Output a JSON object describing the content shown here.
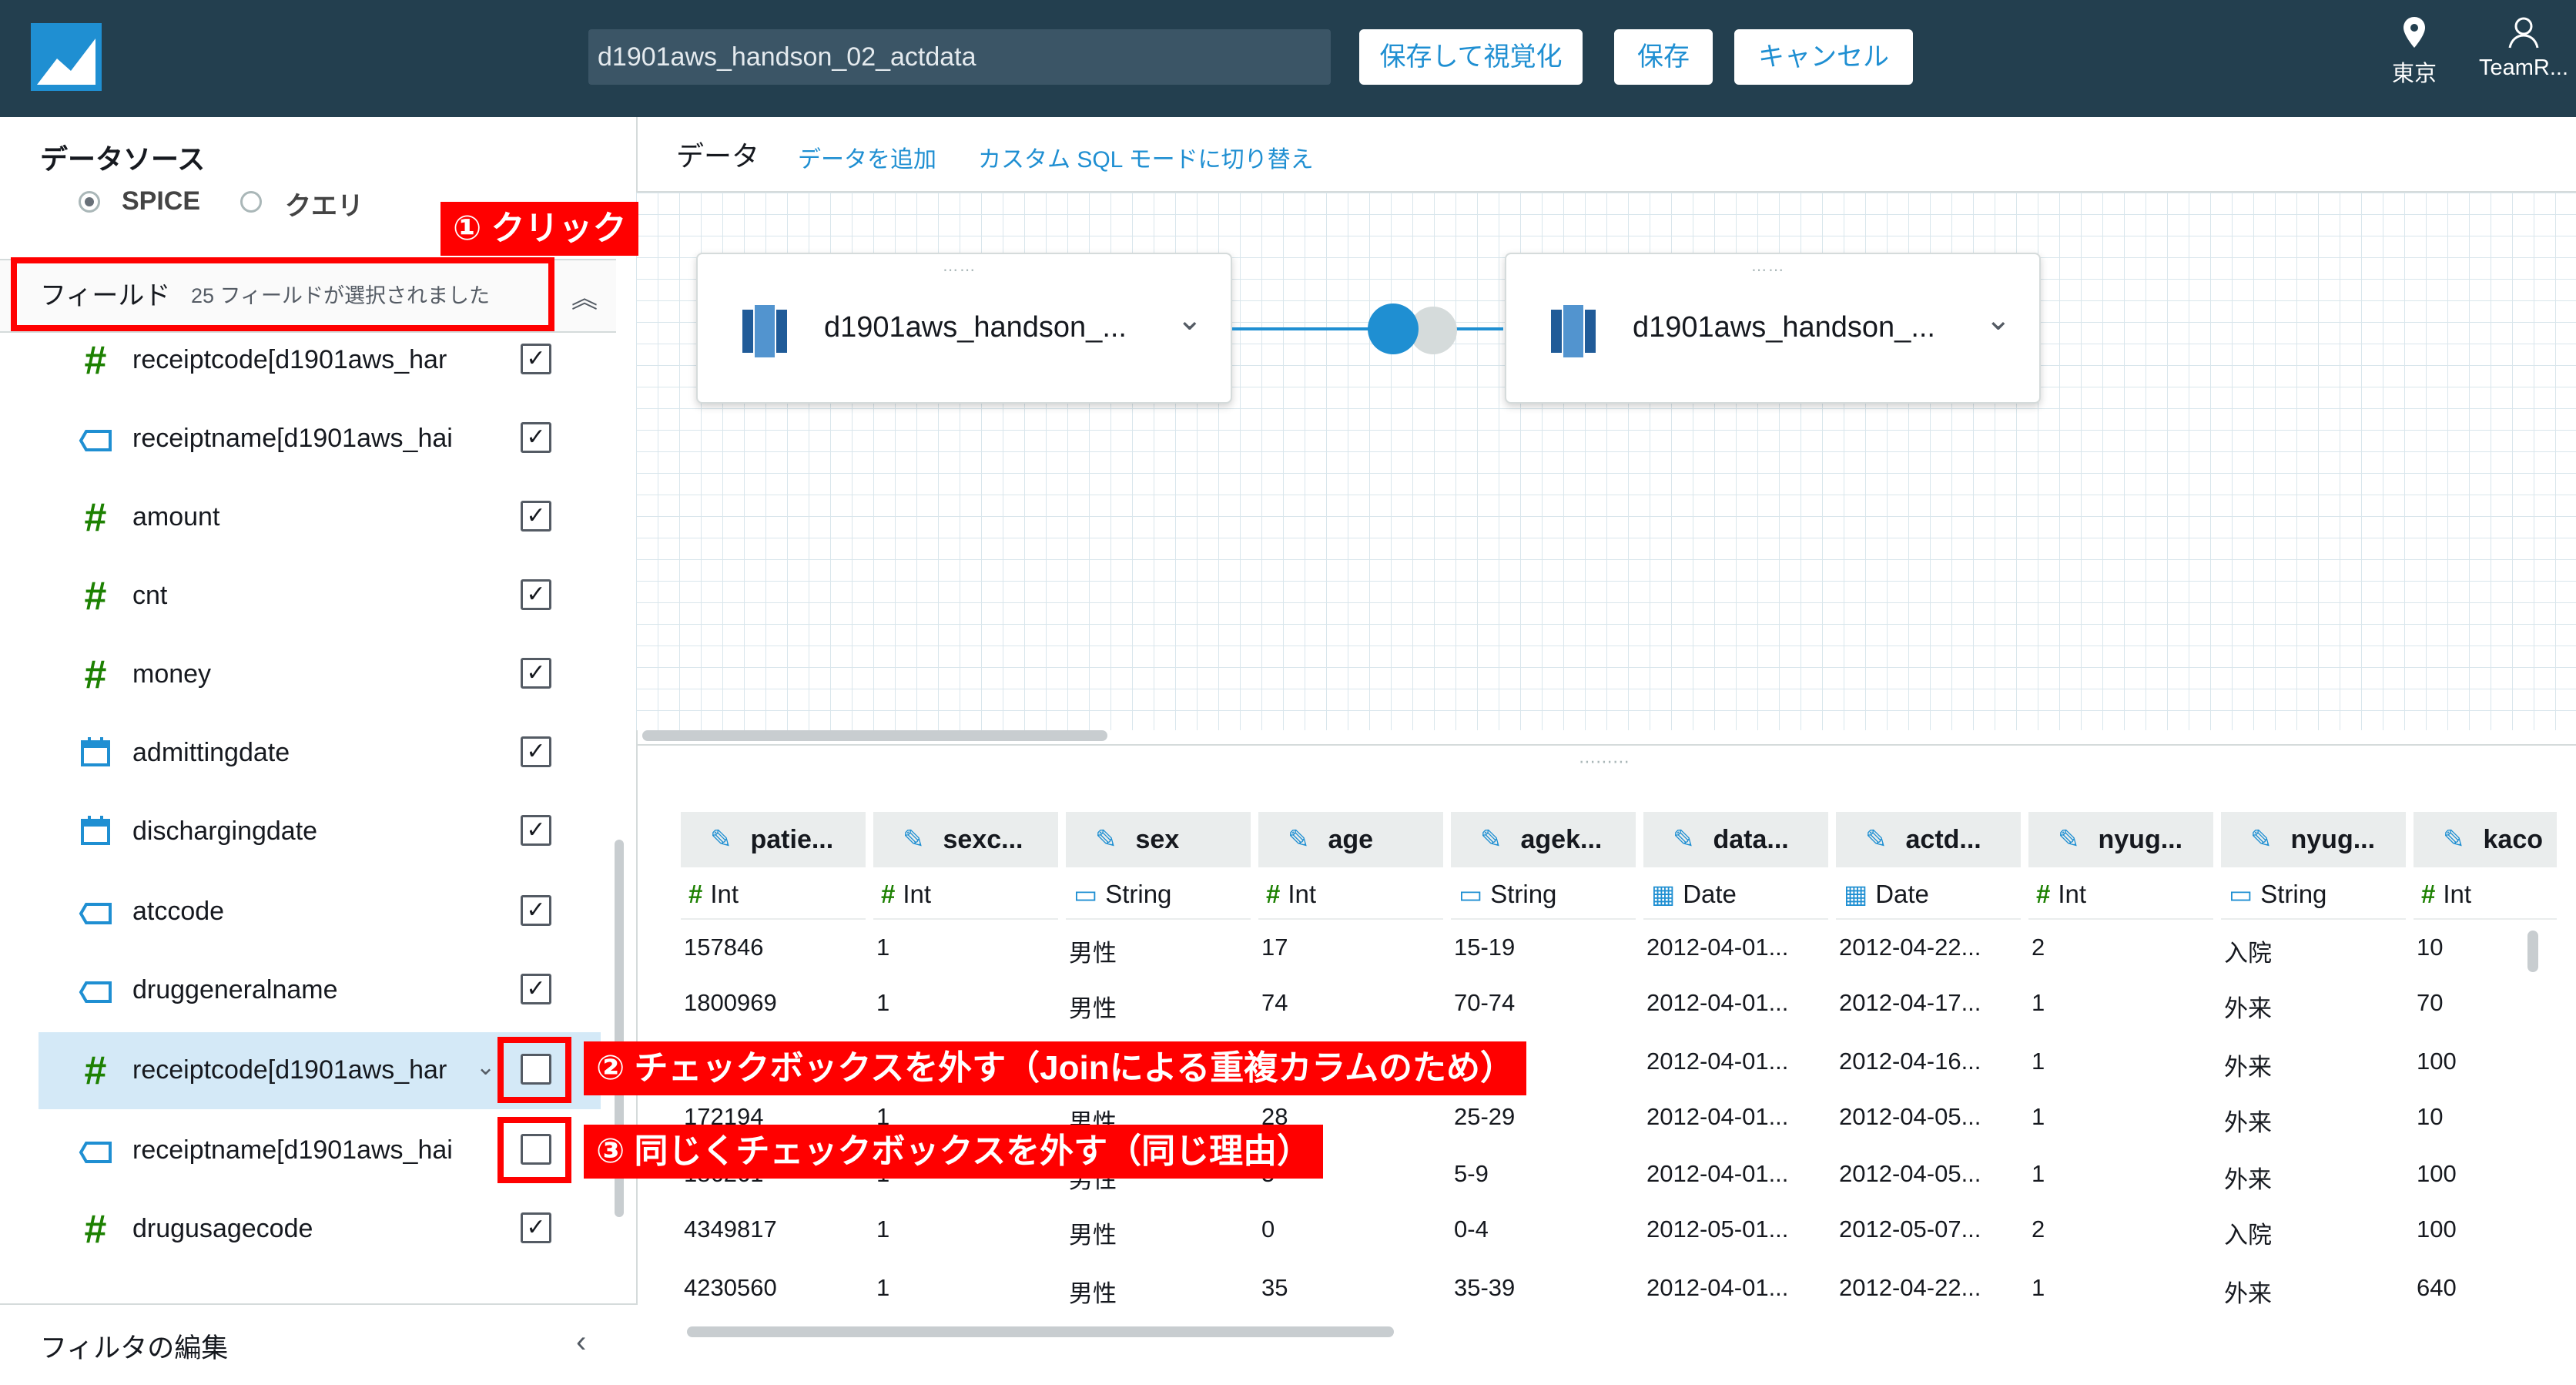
{
  "header": {
    "dataset_name": "d1901aws_handson_02_actdata",
    "save_and_visualize": "保存して視覚化",
    "save": "保存",
    "cancel": "キャンセル",
    "region": "東京",
    "user": "TeamR..."
  },
  "datasource": {
    "title": "データソース",
    "options": [
      "SPICE",
      "クエリ"
    ],
    "selected": "SPICE"
  },
  "fields_panel": {
    "title": "フィールド",
    "count_text": "25 フィールドが選択されました",
    "items": [
      {
        "name": "receiptcode[d1901aws_har",
        "type": "hash-icon",
        "checked": true
      },
      {
        "name": "receiptname[d1901aws_hai",
        "type": "tag-icon",
        "checked": true
      },
      {
        "name": "amount",
        "type": "hash-icon",
        "checked": true
      },
      {
        "name": "cnt",
        "type": "hash-icon",
        "checked": true
      },
      {
        "name": "money",
        "type": "hash-icon",
        "checked": true
      },
      {
        "name": "admittingdate",
        "type": "calendar-icon",
        "checked": true
      },
      {
        "name": "dischargingdate",
        "type": "calendar-icon",
        "checked": true
      },
      {
        "name": "atccode",
        "type": "tag-icon",
        "checked": true
      },
      {
        "name": "druggeneralname",
        "type": "tag-icon",
        "checked": true
      },
      {
        "name": "receiptcode[d1901aws_har",
        "type": "hash-icon",
        "checked": false
      },
      {
        "name": "receiptname[d1901aws_hai",
        "type": "tag-icon",
        "checked": false
      },
      {
        "name": "drugusagecode",
        "type": "hash-icon",
        "checked": true
      }
    ],
    "filter_edit": "フィルタの編集"
  },
  "main": {
    "tab_data": "データ",
    "add_data": "データを追加",
    "custom_sql": "カスタム SQL モードに切り替え",
    "datasets": [
      "d1901aws_handson_...",
      "d1901aws_handson_..."
    ]
  },
  "table": {
    "columns": [
      {
        "name": "patie...",
        "type": "Int"
      },
      {
        "name": "sexc...",
        "type": "Int"
      },
      {
        "name": "sex",
        "type": "String"
      },
      {
        "name": "age",
        "type": "Int"
      },
      {
        "name": "agek...",
        "type": "String"
      },
      {
        "name": "data...",
        "type": "Date"
      },
      {
        "name": "actd...",
        "type": "Date"
      },
      {
        "name": "nyug...",
        "type": "Int"
      },
      {
        "name": "nyug...",
        "type": "String"
      },
      {
        "name": "kaco",
        "type": "Int"
      }
    ],
    "rows": [
      [
        "157846",
        "1",
        "男性",
        "17",
        "15-19",
        "2012-04-01...",
        "2012-04-22...",
        "2",
        "入院",
        "10"
      ],
      [
        "1800969",
        "1",
        "男性",
        "74",
        "70-74",
        "2012-04-01...",
        "2012-04-17...",
        "1",
        "外来",
        "70"
      ],
      [
        "",
        "",
        "",
        "",
        "",
        "2012-04-01...",
        "2012-04-16...",
        "1",
        "外来",
        "100"
      ],
      [
        "172194",
        "1",
        "男性",
        "28",
        "25-29",
        "2012-04-01...",
        "2012-04-05...",
        "1",
        "外来",
        "10"
      ],
      [
        "186261",
        "1",
        "男性",
        "5",
        "5-9",
        "2012-04-01...",
        "2012-04-05...",
        "1",
        "外来",
        "100"
      ],
      [
        "4349817",
        "1",
        "男性",
        "0",
        "0-4",
        "2012-05-01...",
        "2012-05-07...",
        "2",
        "入院",
        "100"
      ],
      [
        "4230560",
        "1",
        "男性",
        "35",
        "35-39",
        "2012-04-01...",
        "2012-04-22...",
        "1",
        "外来",
        "640"
      ]
    ]
  },
  "annotations": {
    "step1": "① クリック",
    "step2": "② チェックボックスを外す（Joinによる重複カラムのため）",
    "step3": "③ 同じくチェックボックスを外す（同じ理由）"
  },
  "colors": {
    "header_bg": "#233f4f",
    "accent": "#1f8fd2",
    "annotation_red": "#ff0000",
    "number_icon": "#1d8102"
  }
}
